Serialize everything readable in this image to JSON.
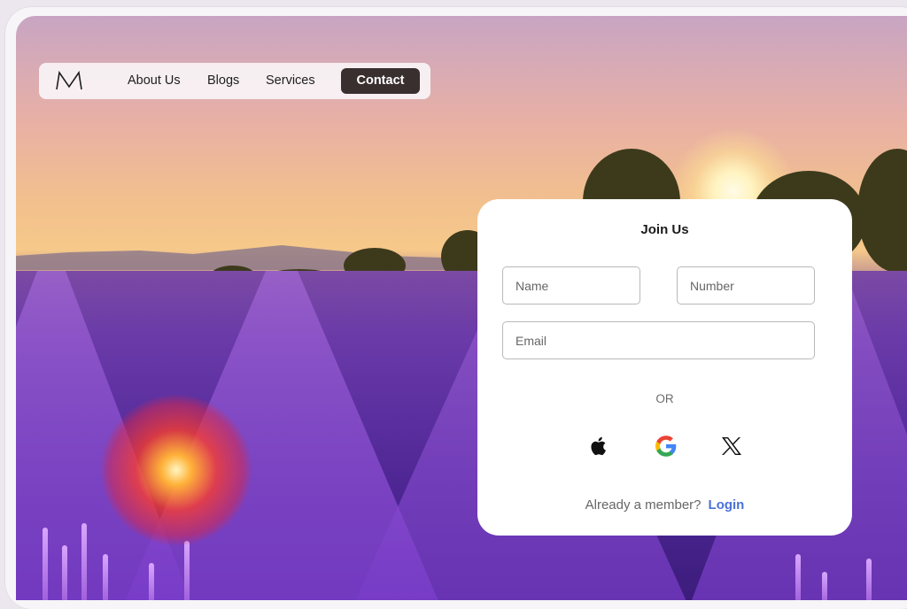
{
  "nav": {
    "logo_letter": "M",
    "links": [
      "About Us",
      "Blogs",
      "Services"
    ],
    "contact_label": "Contact"
  },
  "join_card": {
    "title": "Join Us",
    "name_placeholder": "Name",
    "number_placeholder": "Number",
    "email_placeholder": "Email",
    "divider_text": "OR",
    "social_icons": [
      "apple-icon",
      "google-icon",
      "x-icon"
    ],
    "member_prompt": "Already a member?",
    "login_label": "Login"
  },
  "colors": {
    "contact_button_bg": "#3a2f2f",
    "login_link": "#4a72d6",
    "card_bg": "#ffffff",
    "nav_bg": "#f8f4f6"
  }
}
